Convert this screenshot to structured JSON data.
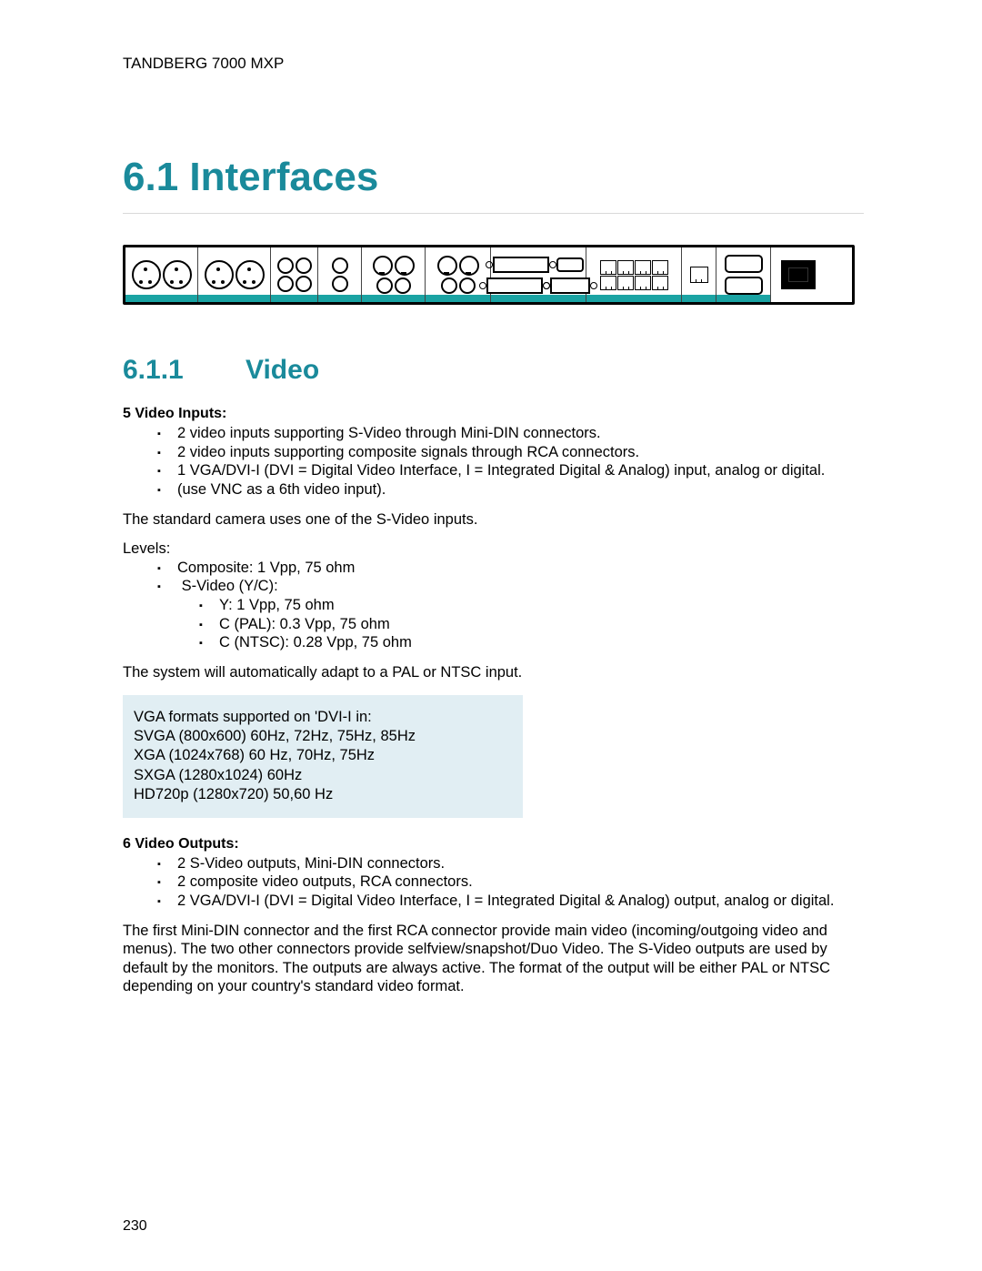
{
  "header": {
    "product": "TANDBERG 7000 MXP"
  },
  "section": {
    "number": "6.1",
    "title": "Interfaces"
  },
  "subsection": {
    "number": "6.1.1",
    "title": "Video"
  },
  "video_inputs": {
    "heading": "5 Video Inputs:",
    "items": [
      "2 video inputs supporting S-Video through Mini-DIN connectors.",
      "2 video inputs supporting composite signals through RCA connectors.",
      "1 VGA/DVI-I (DVI = Digital Video Interface, I = Integrated Digital & Analog) input, analog or digital.",
      "(use VNC as a 6th video input)."
    ]
  },
  "camera_note": "The standard camera uses one of the S-Video inputs.",
  "levels": {
    "heading": "Levels:",
    "items": [
      "Composite: 1 Vpp, 75 ohm",
      "S-Video (Y/C):"
    ],
    "svideo_sub": [
      "Y: 1 Vpp, 75 ohm",
      "C (PAL): 0.3 Vpp, 75 ohm",
      "C (NTSC): 0.28 Vpp, 75 ohm"
    ]
  },
  "pal_ntsc_note": "The system will automatically adapt to a PAL or NTSC input.",
  "vga_box": {
    "l1": "VGA formats supported on 'DVI-I in:",
    "l2": "SVGA (800x600) 60Hz, 72Hz, 75Hz, 85Hz",
    "l3": "XGA (1024x768) 60 Hz, 70Hz, 75Hz",
    "l4": "SXGA (1280x1024) 60Hz",
    "l5": "HD720p (1280x720) 50,60 Hz"
  },
  "video_outputs": {
    "heading": "6 Video Outputs:",
    "items": [
      "2 S-Video outputs, Mini-DIN connectors.",
      "2 composite video outputs, RCA connectors.",
      "2 VGA/DVI-I (DVI = Digital Video Interface, I = Integrated Digital & Analog) output, analog or digital."
    ]
  },
  "outputs_para": "The first Mini-DIN connector and the first RCA connector provide main video (incoming/outgoing video and menus). The two other connectors provide selfview/snapshot/Duo Video. The S-Video outputs are used by default by the monitors. The outputs are always active. The format of the output will be either PAL or NTSC depending on your country's standard video format.",
  "page_number": "230"
}
